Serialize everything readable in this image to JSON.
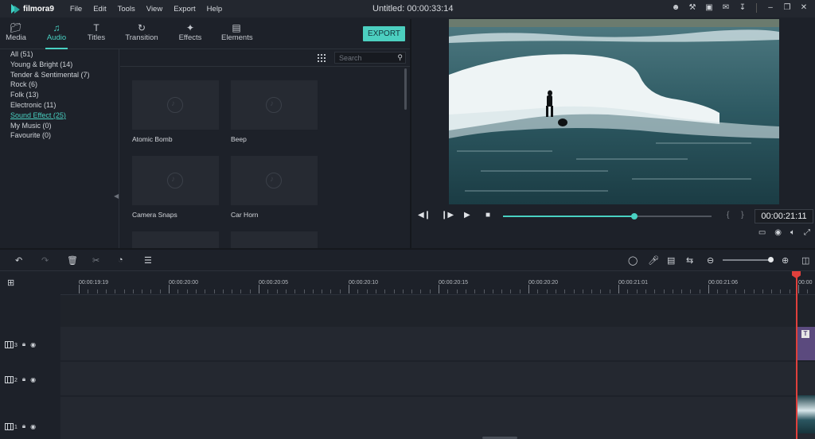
{
  "app": {
    "logo_text": "filmora9",
    "menu": [
      "File",
      "Edit",
      "Tools",
      "View",
      "Export",
      "Help"
    ],
    "project_title": "Untitled:",
    "project_duration": "00:00:33:14"
  },
  "tabs": [
    {
      "label": "Media",
      "icon": "folder-icon",
      "active": false
    },
    {
      "label": "Audio",
      "icon": "music-note-icon",
      "active": true
    },
    {
      "label": "Titles",
      "icon": "text-icon",
      "active": false
    },
    {
      "label": "Transition",
      "icon": "transition-icon",
      "active": false
    },
    {
      "label": "Effects",
      "icon": "effects-icon",
      "active": false
    },
    {
      "label": "Elements",
      "icon": "image-icon",
      "active": false
    }
  ],
  "export_label": "EXPORT",
  "categories": [
    {
      "label": "All (51)",
      "active": false
    },
    {
      "label": "Young & Bright (14)",
      "active": false
    },
    {
      "label": "Tender & Sentimental (7)",
      "active": false
    },
    {
      "label": "Rock (6)",
      "active": false
    },
    {
      "label": "Folk (13)",
      "active": false
    },
    {
      "label": "Electronic (11)",
      "active": false
    },
    {
      "label": "Sound Effect (25)",
      "active": true
    },
    {
      "label": "My Music (0)",
      "active": false
    },
    {
      "label": "Favourite (0)",
      "active": false
    }
  ],
  "search": {
    "placeholder": "Search"
  },
  "audio_items": [
    {
      "label": "Atomic Bomb"
    },
    {
      "label": "Beep"
    },
    {
      "label": "Camera Snaps"
    },
    {
      "label": "Car Horn"
    },
    {
      "label": ""
    },
    {
      "label": ""
    }
  ],
  "preview": {
    "timecode": "00:00:21:11",
    "progress": 0.63
  },
  "ruler": {
    "labels": [
      "00:00:19:19",
      "00:00:20:00",
      "00:00:20:05",
      "00:00:20:10",
      "00:00:20:15",
      "00:00:20:20",
      "00:00:21:01",
      "00:00:21:06",
      "00:00"
    ]
  },
  "tracks": [
    {
      "number": "3"
    },
    {
      "number": "2"
    },
    {
      "number": "1"
    }
  ],
  "colors": {
    "accent": "#49d1c2",
    "playhead": "#e0403c",
    "background": "#1d2129"
  }
}
